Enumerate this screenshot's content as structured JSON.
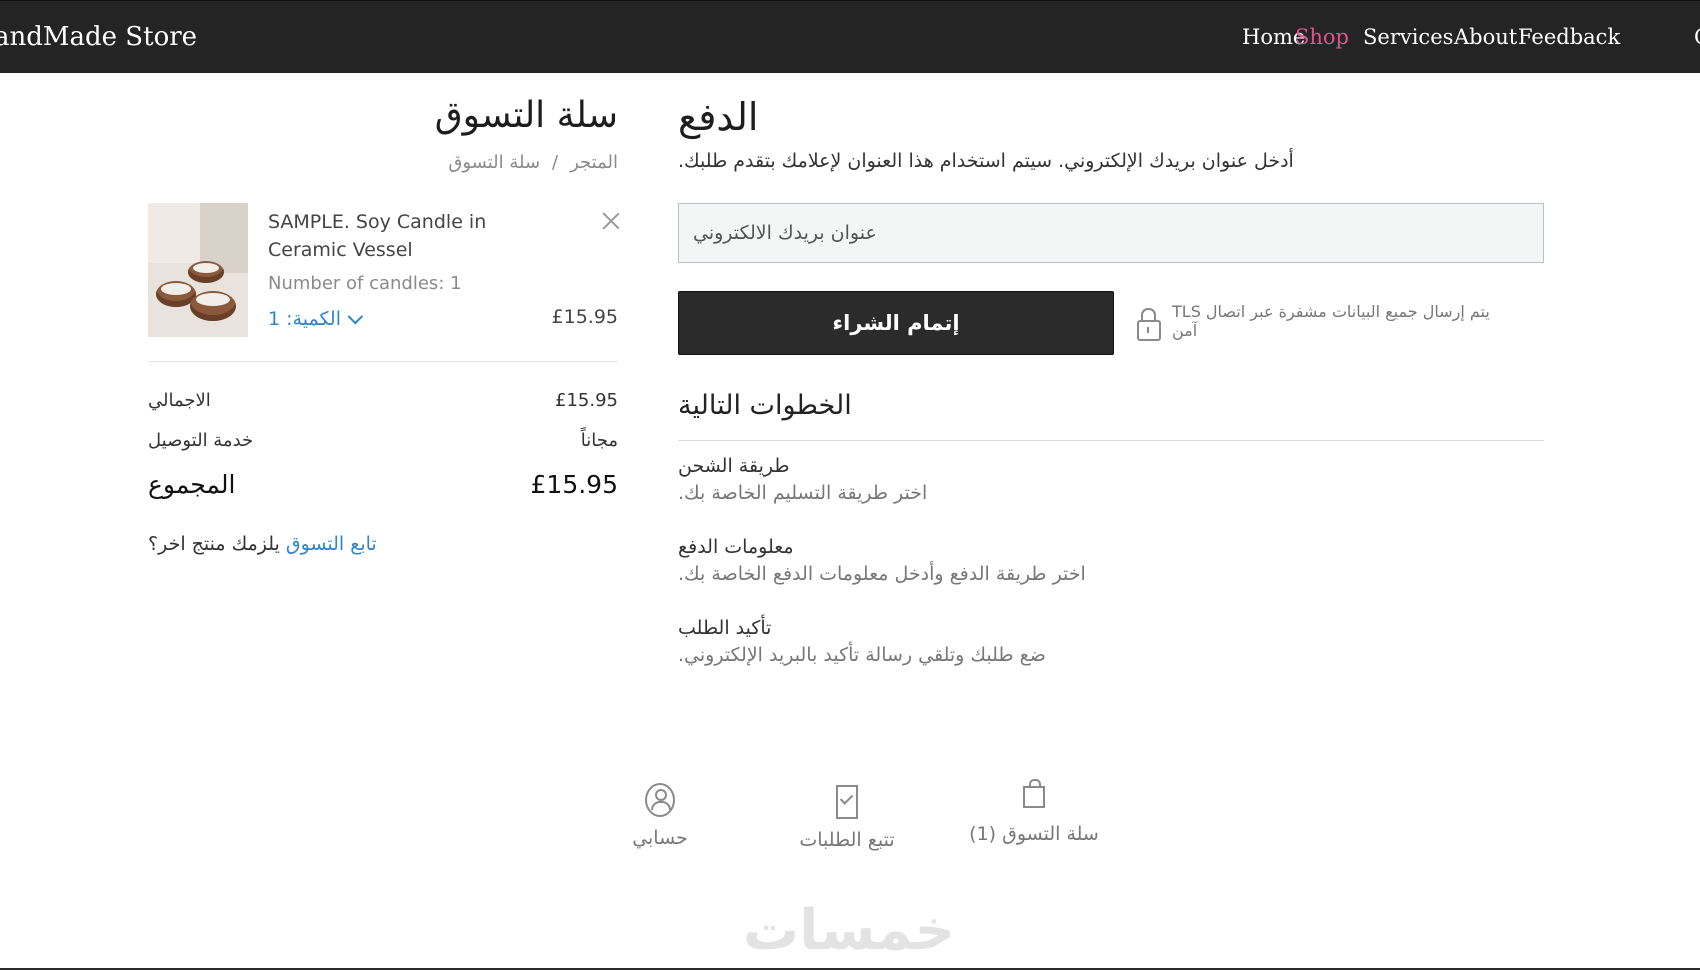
{
  "header": {
    "brand": "andMade Store",
    "nav": [
      {
        "label": "Home",
        "active": false
      },
      {
        "label": "Shop",
        "active": true
      },
      {
        "label": "Services",
        "active": false
      },
      {
        "label": "About",
        "active": false
      },
      {
        "label": "Feedback",
        "active": false
      },
      {
        "label": "C",
        "active": false
      }
    ],
    "active_color": "#e0528a"
  },
  "cart": {
    "title": "سلة التسوق",
    "breadcrumb": {
      "store": "المتجر",
      "separator": "/",
      "current": "سلة التسوق"
    },
    "item": {
      "name": "SAMPLE. Soy Candle in Ceramic Vessel",
      "option": "Number of candles: 1",
      "quantity_label": "الكمية: 1",
      "price": "£15.95"
    },
    "summary": {
      "subtotal_label": "الاجمالي",
      "subtotal_value": "£15.95",
      "delivery_label": "خدمة التوصيل",
      "delivery_value": "مجاناً",
      "total_label": "المجموع",
      "total_value": "£15.95"
    },
    "continue": {
      "prefix": "يلزمك منتج اخر؟",
      "link": "تابع التسوق"
    }
  },
  "payment": {
    "title": "الدفع",
    "description": "أدخل عنوان بريدك الإلكتروني. سيتم استخدام هذا العنوان لإعلامك بتقدم طلبك.",
    "email_placeholder": "عنوان بريدك الالكتروني",
    "email_value": "",
    "checkout_button": "إتمام الشراء",
    "security_note": "يتم إرسال جميع البيانات مشفرة عبر اتصال TLS آمن"
  },
  "next_steps": {
    "title": "الخطوات التالية",
    "steps": [
      {
        "title": "طريقة الشحن",
        "desc": "اختر طريقة التسليم الخاصة بك."
      },
      {
        "title": "معلومات الدفع",
        "desc": "اختر طريقة الدفع وأدخل معلومات الدفع الخاصة بك."
      },
      {
        "title": "تأكيد الطلب",
        "desc": "ضع طلبك وتلقي رسالة تأكيد بالبريد الإلكتروني."
      }
    ]
  },
  "footer_links": [
    {
      "label": "حسابي",
      "icon": "user-icon"
    },
    {
      "label": "تتبع الطلبات",
      "icon": "track-orders-icon"
    },
    {
      "label": "سلة التسوق (1)",
      "icon": "shopping-bag-icon"
    }
  ],
  "watermark": "خمسات"
}
